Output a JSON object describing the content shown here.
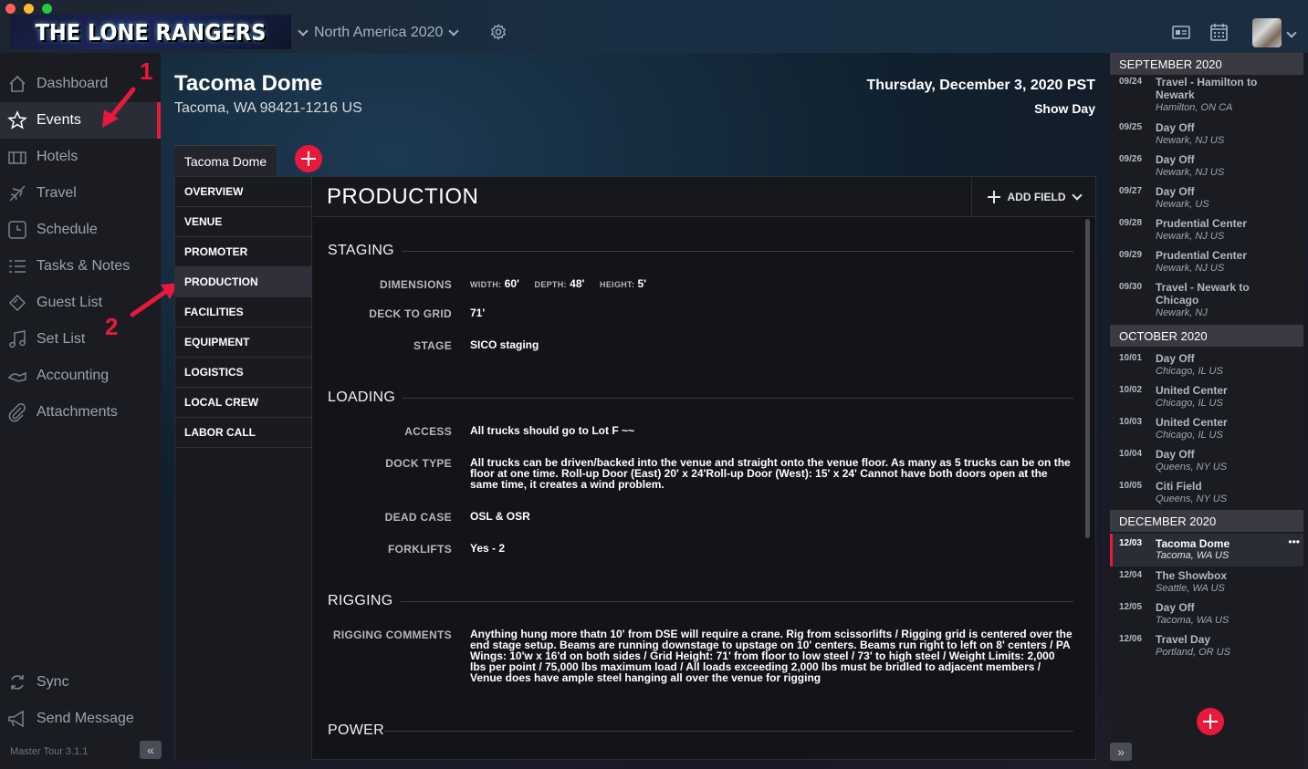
{
  "window": {
    "traffic_colors": [
      "#fe5f57",
      "#febc2e",
      "#28c840"
    ]
  },
  "header": {
    "logo_text": "THE LONE RANGERS",
    "tour_name": "North America 2020",
    "icons": [
      "chevron-down-icon",
      "gear-icon",
      "id-card-icon",
      "calendar-icon",
      "avatar"
    ]
  },
  "sidebar": {
    "items": [
      {
        "label": "Dashboard",
        "icon": "home-icon"
      },
      {
        "label": "Events",
        "icon": "star-icon",
        "active": true
      },
      {
        "label": "Hotels",
        "icon": "hotel-icon"
      },
      {
        "label": "Travel",
        "icon": "plane-icon"
      },
      {
        "label": "Schedule",
        "icon": "clock-icon"
      },
      {
        "label": "Tasks & Notes",
        "icon": "list-icon"
      },
      {
        "label": "Guest List",
        "icon": "ticket-icon"
      },
      {
        "label": "Set List",
        "icon": "music-icon"
      },
      {
        "label": "Accounting",
        "icon": "money-icon"
      },
      {
        "label": "Attachments",
        "icon": "paperclip-icon"
      }
    ],
    "bottom": [
      {
        "label": "Sync",
        "icon": "sync-icon"
      },
      {
        "label": "Send Message",
        "icon": "megaphone-icon"
      }
    ],
    "version": "Master Tour 3.1.1",
    "collapse": "«"
  },
  "annotations": {
    "one": "1",
    "two": "2",
    "color": "#e8193a"
  },
  "event": {
    "venue": "Tacoma Dome",
    "address": "Tacoma, WA 98421-1216 US",
    "date": "Thursday, December 3, 2020 PST",
    "day_type": "Show Day",
    "tab": "Tacoma Dome"
  },
  "sections": [
    "OVERVIEW",
    "VENUE",
    "PROMOTER",
    "PRODUCTION",
    "FACILITIES",
    "EQUIPMENT",
    "LOGISTICS",
    "LOCAL CREW",
    "LABOR CALL"
  ],
  "production": {
    "title": "PRODUCTION",
    "add_field": "ADD FIELD",
    "staging": {
      "title": "STAGING",
      "dimensions_label": "DIMENSIONS",
      "width_label": "WIDTH:",
      "width": "60'",
      "depth_label": "DEPTH:",
      "depth": "48'",
      "height_label": "HEIGHT:",
      "height": "5'",
      "deck_label": "DECK TO GRID",
      "deck": "71'",
      "stage_label": "STAGE",
      "stage": "SICO staging"
    },
    "loading": {
      "title": "LOADING",
      "access_label": "ACCESS",
      "access": "All trucks should go to Lot F ~~",
      "dock_label": "DOCK TYPE",
      "dock": "All trucks can be driven/backed into the venue and straight onto the venue floor. As many as 5 trucks can be on the floor at one time. Roll-up Door (East) 20' x 24'Roll-up Door (West): 15' x 24' Cannot have both doors open at the same time, it creates a wind problem.",
      "dead_label": "DEAD CASE",
      "dead": "OSL & OSR",
      "forklift_label": "FORKLIFTS",
      "forklift": "Yes - 2"
    },
    "rigging": {
      "title": "RIGGING",
      "comments_label": "RIGGING COMMENTS",
      "comments": "Anything hung more thatn 10' from DSE will require a crane. Rig from scissorlifts / Rigging grid is centered over the end stage setup. Beams are running downstage to upstage on 10' centers. Beams run right to left on 8' centers / PA Wings: 10'w x 16'd on both sides / Grid Height: 71' from floor to low steel / 73' to high steel / Weight Limits: 2,000 lbs per point / 75,000 lbs maximum load / All loads exceeding 2,000 lbs must be bridled to adjacent members / Venue does have ample steel hanging all over the venue for rigging"
    },
    "power": {
      "title": "POWER"
    }
  },
  "schedule": {
    "months": [
      {
        "name": "SEPTEMBER 2020",
        "items": [
          {
            "date": "09/24",
            "title": "Travel - Hamilton to Newark",
            "loc": "Hamilton, ON CA"
          },
          {
            "date": "09/25",
            "title": "Day Off",
            "loc": "Newark, NJ US"
          },
          {
            "date": "09/26",
            "title": "Day Off",
            "loc": "Newark, NJ US"
          },
          {
            "date": "09/27",
            "title": "Day Off",
            "loc": "Newark, US"
          },
          {
            "date": "09/28",
            "title": "Prudential Center",
            "loc": "Newark, NJ US"
          },
          {
            "date": "09/29",
            "title": "Prudential Center",
            "loc": "Newark, NJ US"
          },
          {
            "date": "09/30",
            "title": "Travel - Newark to Chicago",
            "loc": "Newark, NJ"
          }
        ]
      },
      {
        "name": "OCTOBER 2020",
        "items": [
          {
            "date": "10/01",
            "title": "Day Off",
            "loc": "Chicago, IL US"
          },
          {
            "date": "10/02",
            "title": "United Center",
            "loc": "Chicago, IL US"
          },
          {
            "date": "10/03",
            "title": "United Center",
            "loc": "Chicago, IL US"
          },
          {
            "date": "10/04",
            "title": "Day Off",
            "loc": "Queens, NY US"
          },
          {
            "date": "10/05",
            "title": "Citi Field",
            "loc": "Queens, NY US"
          }
        ]
      },
      {
        "name": "DECEMBER 2020",
        "items": [
          {
            "date": "12/03",
            "title": "Tacoma Dome",
            "loc": "Tacoma, WA US",
            "active": true
          },
          {
            "date": "12/04",
            "title": "The Showbox",
            "loc": "Seattle, WA US"
          },
          {
            "date": "12/05",
            "title": "Day Off",
            "loc": "Tacoma, WA US"
          },
          {
            "date": "12/06",
            "title": "Travel Day",
            "loc": "Portland, OR US"
          }
        ]
      }
    ],
    "more": "•••",
    "expand": "»"
  },
  "colors": {
    "accent": "#e8193a",
    "sidebar_bg": "#1b1b22",
    "panel_bg": "#141418"
  }
}
